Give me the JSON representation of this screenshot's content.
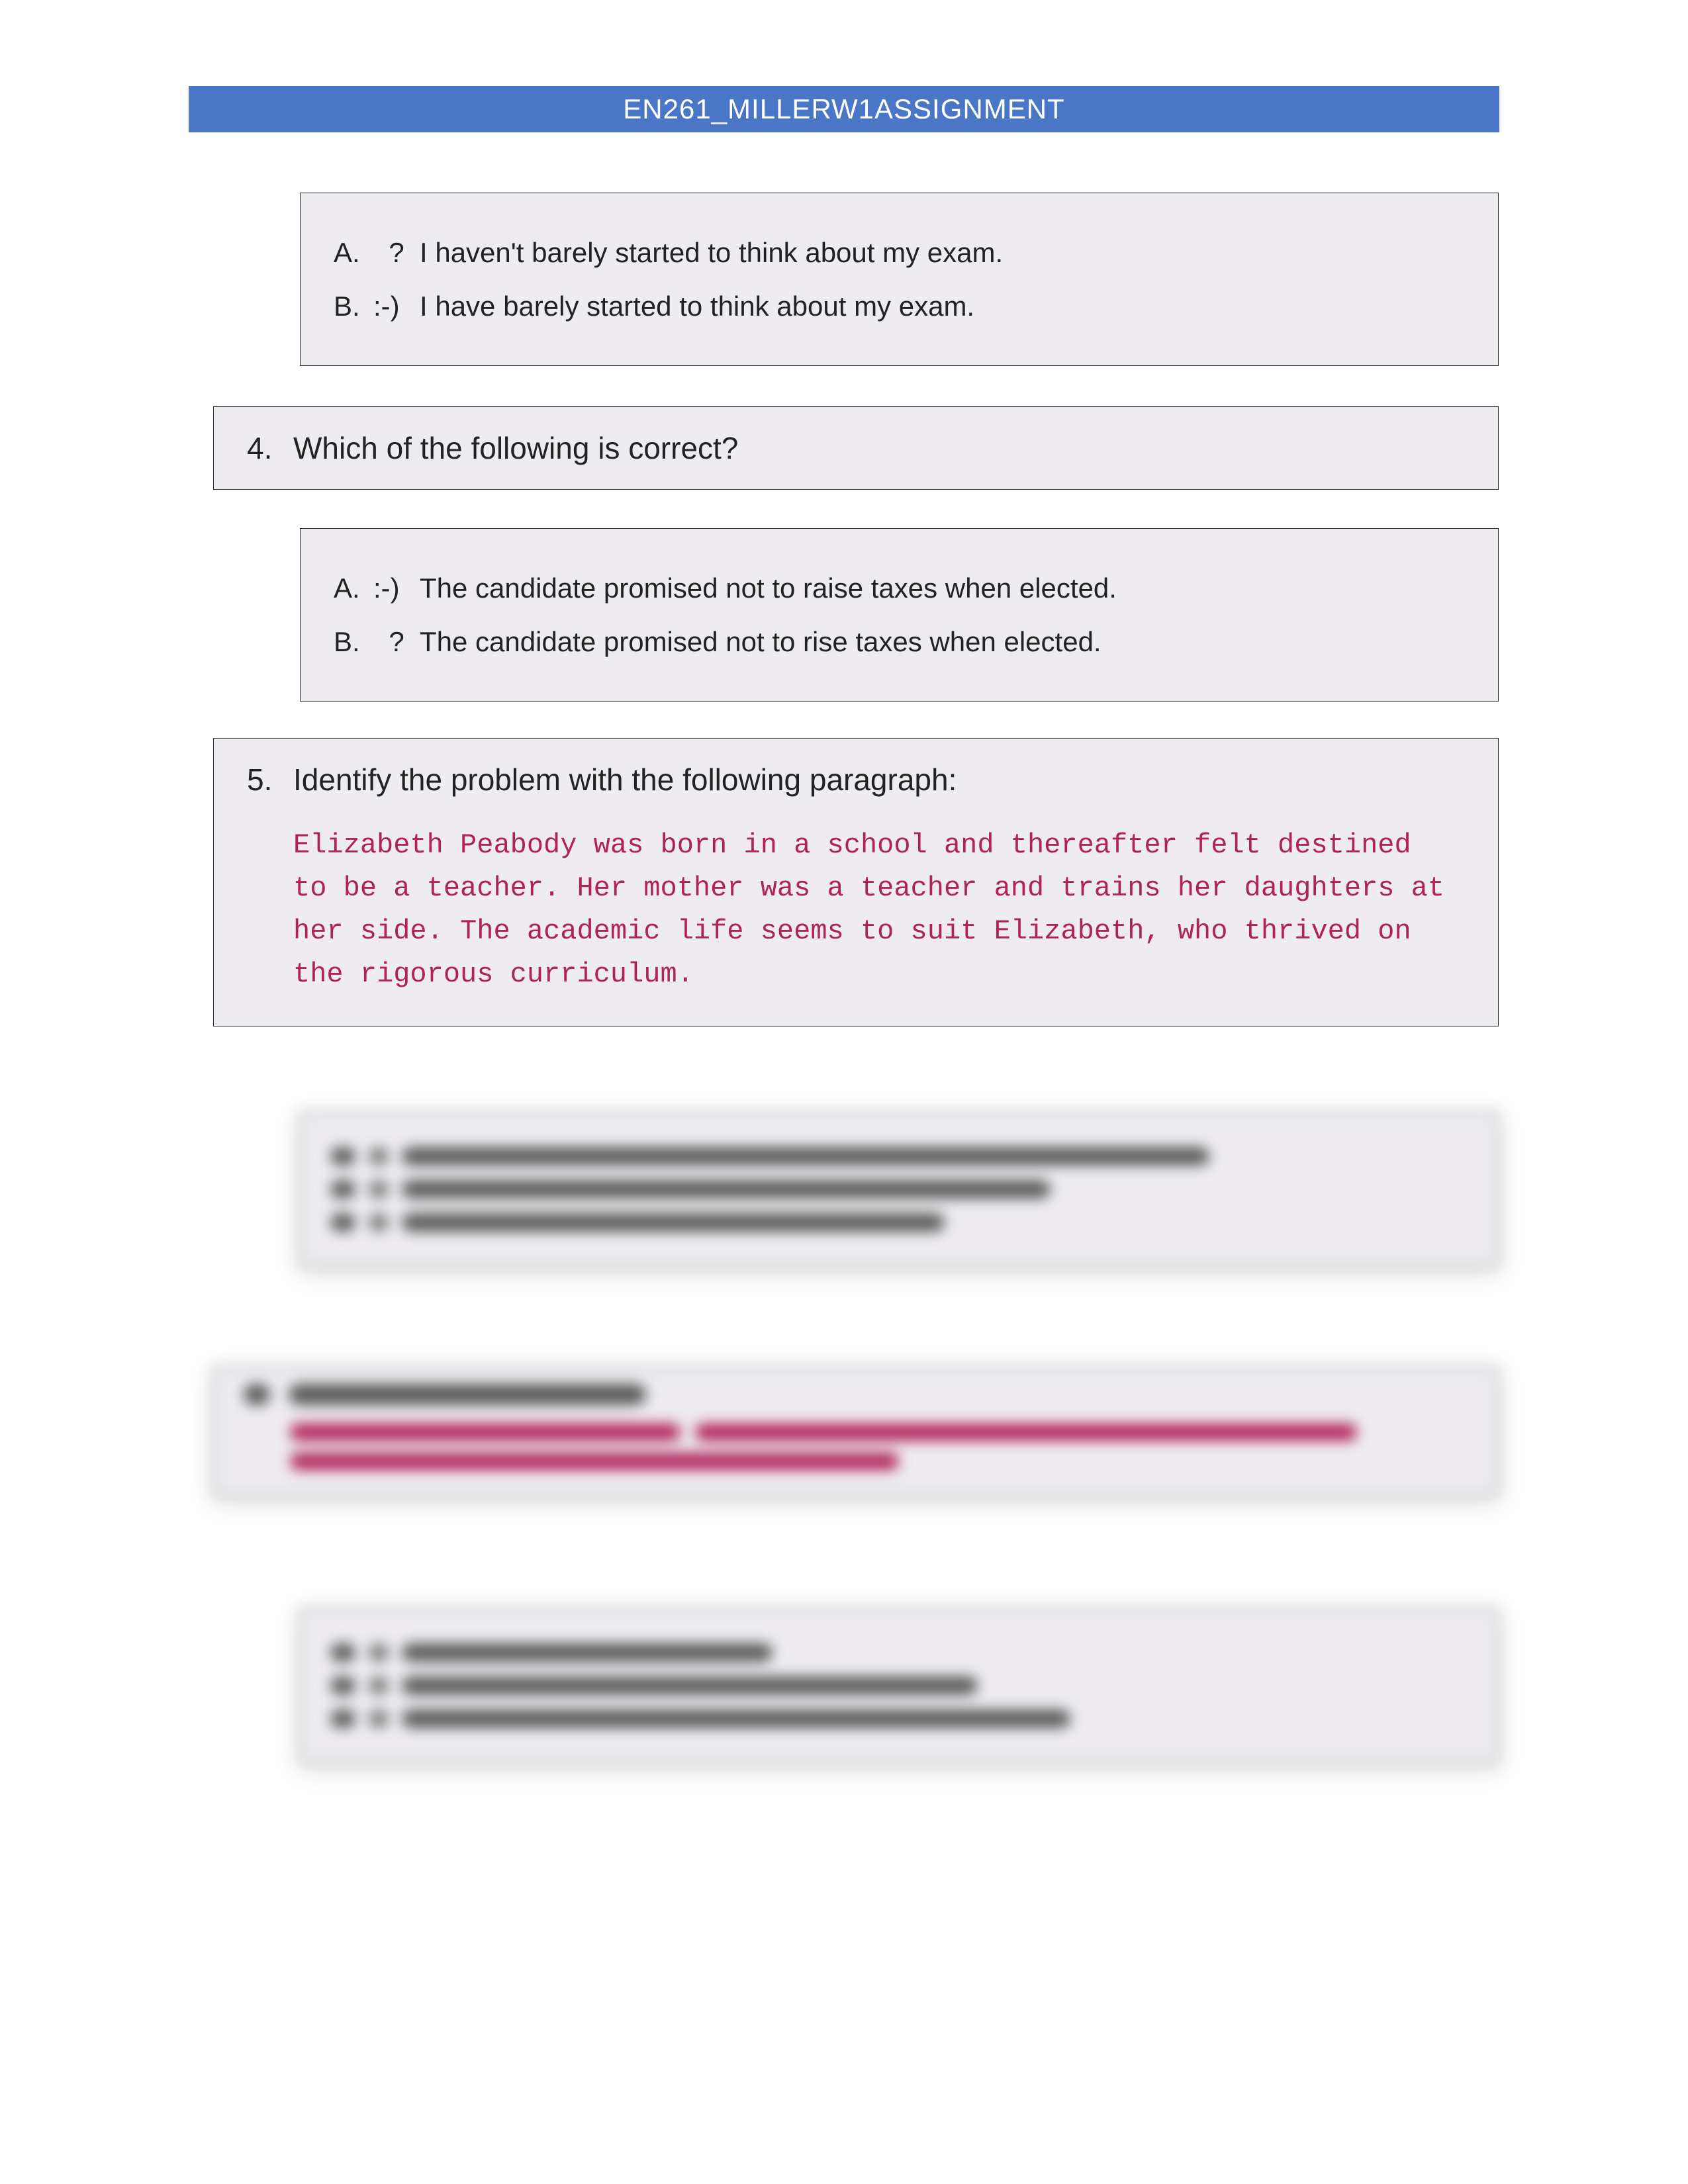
{
  "header": {
    "title": "EN261_MILLERW1ASSIGNMENT"
  },
  "block3_answers": {
    "a": {
      "letter": "A.",
      "mark": "?",
      "text": "I haven't barely started to think about my exam."
    },
    "b": {
      "letter": "B.",
      "mark": ":-)",
      "text": "I have barely started to think about my exam."
    }
  },
  "q4": {
    "number": "4.",
    "prompt": "Which of the following is correct?",
    "a": {
      "letter": "A.",
      "mark": ":-)",
      "text": "The candidate promised not to raise taxes when elected."
    },
    "b": {
      "letter": "B.",
      "mark": "?",
      "text": "The candidate promised not to rise taxes when elected."
    }
  },
  "q5": {
    "number": "5.",
    "prompt": "Identify the problem with the following paragraph:",
    "paragraph": "Elizabeth Peabody was born in a school and thereafter felt destined to be a teacher. Her mother was a teacher and trains her daughters at her side. The academic life seems to suit Elizabeth, who thrived on the rigorous curriculum."
  }
}
